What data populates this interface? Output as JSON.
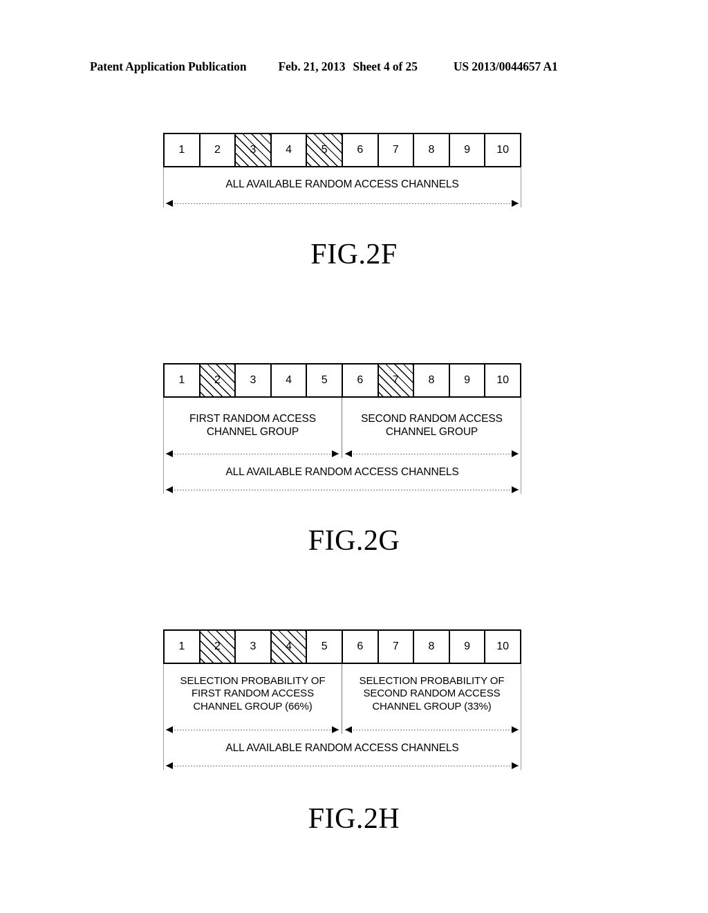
{
  "header": {
    "publication": "Patent Application Publication",
    "date": "Feb. 21, 2013",
    "sheet": "Sheet 4 of 25",
    "publication_number": "US 2013/0044657 A1"
  },
  "figures": [
    {
      "id": "2F",
      "caption": "FIG.2F",
      "channels": [
        "1",
        "2",
        "3",
        "4",
        "5",
        "6",
        "7",
        "8",
        "9",
        "10"
      ],
      "hatched_channels": [
        "3",
        "5"
      ],
      "overall_label": "ALL AVAILABLE RANDOM ACCESS CHANNELS",
      "groups": []
    },
    {
      "id": "2G",
      "caption": "FIG.2G",
      "channels": [
        "1",
        "2",
        "3",
        "4",
        "5",
        "6",
        "7",
        "8",
        "9",
        "10"
      ],
      "hatched_channels": [
        "2",
        "7"
      ],
      "overall_label": "ALL AVAILABLE RANDOM ACCESS CHANNELS",
      "groups": [
        {
          "label": "FIRST RANDOM ACCESS\nCHANNEL GROUP",
          "span": 5
        },
        {
          "label": "SECOND RANDOM ACCESS\nCHANNEL GROUP",
          "span": 5
        }
      ]
    },
    {
      "id": "2H",
      "caption": "FIG.2H",
      "channels": [
        "1",
        "2",
        "3",
        "4",
        "5",
        "6",
        "7",
        "8",
        "9",
        "10"
      ],
      "hatched_channels": [
        "2",
        "4"
      ],
      "overall_label": "ALL AVAILABLE RANDOM ACCESS CHANNELS",
      "groups": [
        {
          "label": "SELECTION PROBABILITY OF\nFIRST RANDOM ACCESS\nCHANNEL GROUP (66%)",
          "span": 5
        },
        {
          "label": "SELECTION PROBABILITY OF\nSECOND RANDOM ACCESS\nCHANNEL GROUP (33%)",
          "span": 5
        }
      ]
    }
  ],
  "colors": {
    "ink": "#000000",
    "paper": "#ffffff",
    "dimension_line": "#7a7a7a"
  }
}
